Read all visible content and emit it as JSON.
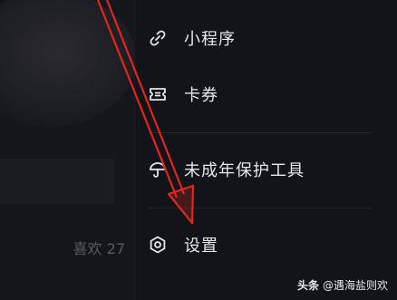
{
  "left": {
    "likes_label": "喜欢 27"
  },
  "menu": {
    "items": [
      {
        "label": "小程序",
        "icon": "link-icon"
      },
      {
        "label": "卡券",
        "icon": "ticket-icon"
      },
      {
        "label": "未成年保护工具",
        "icon": "umbrella-icon"
      },
      {
        "label": "设置",
        "icon": "gear-icon"
      }
    ]
  },
  "annotation": {
    "arrow_color": "#e0261f"
  },
  "watermark": {
    "logo": "头条",
    "text": "@遇海盐则欢"
  },
  "colors": {
    "background": "#111217",
    "menu_text": "#e6e7ea",
    "muted_text": "#5a5b62"
  }
}
